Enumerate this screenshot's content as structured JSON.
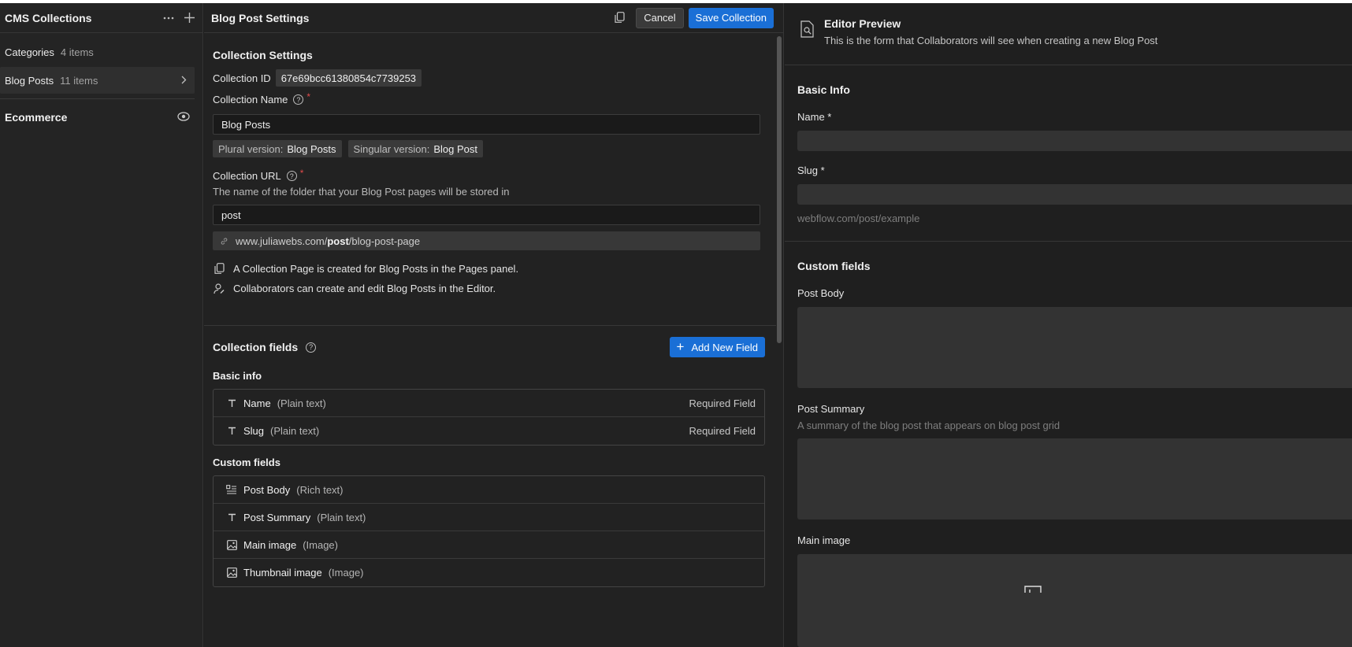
{
  "sidebar": {
    "title": "CMS Collections",
    "more_icon": "more-horizontal-icon",
    "add_icon": "plus-icon",
    "collections": [
      {
        "name": "Categories",
        "count": "4 items"
      },
      {
        "name": "Blog Posts",
        "count": "11 items"
      }
    ],
    "ecommerce_title": "Ecommerce"
  },
  "settings": {
    "title": "Blog Post Settings",
    "cancel_label": "Cancel",
    "save_label": "Save Collection",
    "section_title": "Collection Settings",
    "collection_id_label": "Collection ID",
    "collection_id_value": "67e69bcc61380854c7739253",
    "collection_name_label": "Collection Name",
    "required_mark": "*",
    "collection_name_value": "Blog Posts",
    "plural_label": "Plural version:",
    "plural_value": "Blog Posts",
    "singular_label": "Singular version:",
    "singular_value": "Blog Post",
    "collection_url_label": "Collection URL",
    "collection_url_hint": "The name of the folder that your Blog Post pages will be stored in",
    "collection_url_value": "post",
    "url_prefix": "www.juliawebs.com/",
    "url_slug": "post",
    "url_suffix": "/blog-post-page",
    "info_pages": "A Collection Page is created for Blog Posts in the Pages panel.",
    "info_editor": "Collaborators can create and edit Blog Posts in the Editor.",
    "fields_title": "Collection fields",
    "add_field_label": "Add New Field",
    "basic_info_title": "Basic info",
    "basic_fields": [
      {
        "name": "Name",
        "type": "(Plain text)",
        "required": "Required Field",
        "icon": "text-type-icon"
      },
      {
        "name": "Slug",
        "type": "(Plain text)",
        "required": "Required Field",
        "icon": "text-type-icon"
      }
    ],
    "custom_fields_title": "Custom fields",
    "custom_fields": [
      {
        "name": "Post Body",
        "type": "(Rich text)",
        "icon": "rich-text-icon"
      },
      {
        "name": "Post Summary",
        "type": "(Plain text)",
        "icon": "text-type-icon"
      },
      {
        "name": "Main image",
        "type": "(Image)",
        "icon": "image-icon"
      },
      {
        "name": "Thumbnail image",
        "type": "(Image)",
        "icon": "image-icon"
      }
    ]
  },
  "preview": {
    "title": "Editor Preview",
    "subtitle": "This is the form that Collaborators will see when creating a new Blog Post",
    "basic_info_title": "Basic Info",
    "name_label": "Name *",
    "slug_label": "Slug *",
    "slug_hint": "webflow.com/post/example",
    "custom_fields_title": "Custom fields",
    "post_body_label": "Post Body",
    "post_summary_label": "Post Summary",
    "post_summary_hint": "A summary of the blog post that appears on blog post grid",
    "main_image_label": "Main image"
  },
  "colors": {
    "accent": "#1a6fd6",
    "required": "#e04b4b",
    "background": "#1e1e1e"
  }
}
